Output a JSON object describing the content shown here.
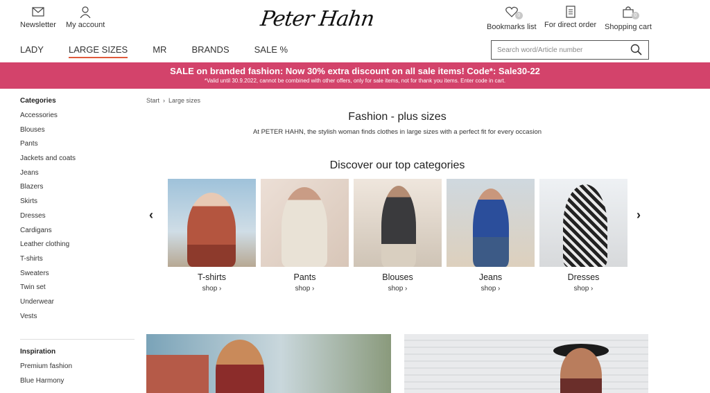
{
  "header": {
    "newsletter": "Newsletter",
    "account": "My account",
    "logo": "Peter Hahn",
    "bookmarks": "Bookmarks list",
    "bookmarks_count": "0",
    "direct_order": "For direct order",
    "cart": "Shopping cart",
    "cart_count": "0"
  },
  "nav": {
    "items": [
      "LADY",
      "LARGE SIZES",
      "MR",
      "BRANDS",
      "SALE %"
    ],
    "search_placeholder": "Search word/Article number"
  },
  "banner": {
    "headline": "SALE on branded fashion: Now 30% extra discount on all sale items! Code*: Sale30-22",
    "note": "*Valid until 30.9.2022, cannot be combined with other offers, only for sale items, not for thank you items. Enter code in cart."
  },
  "sidebar": {
    "categories_title": "Categories",
    "categories": [
      "Accessories",
      "Blouses",
      "Pants",
      "Jackets and coats",
      "Jeans",
      "Blazers",
      "Skirts",
      "Dresses",
      "Cardigans",
      "Leather clothing",
      "T-shirts",
      "Sweaters",
      "Twin set",
      "Underwear",
      "Vests"
    ],
    "inspiration_title": "Inspiration",
    "inspiration": [
      "Premium fashion",
      "Blue Harmony"
    ]
  },
  "breadcrumb": {
    "start": "Start",
    "sep": "›",
    "current": "Large sizes"
  },
  "main": {
    "title": "Fashion - plus sizes",
    "subtitle": "At PETER HAHN, the stylish woman finds clothes in large sizes with a perfect fit for every occasion",
    "top_title": "Discover our top categories",
    "prev": "‹",
    "next": "›"
  },
  "top_categories": [
    {
      "label": "T-shirts",
      "shop": "shop ›"
    },
    {
      "label": "Pants",
      "shop": "shop ›"
    },
    {
      "label": "Blouses",
      "shop": "shop ›"
    },
    {
      "label": "Jeans",
      "shop": "shop ›"
    },
    {
      "label": "Dresses",
      "shop": "shop ›"
    }
  ],
  "colors": {
    "banner": "#d3436b",
    "accent": "#e05a3c"
  }
}
